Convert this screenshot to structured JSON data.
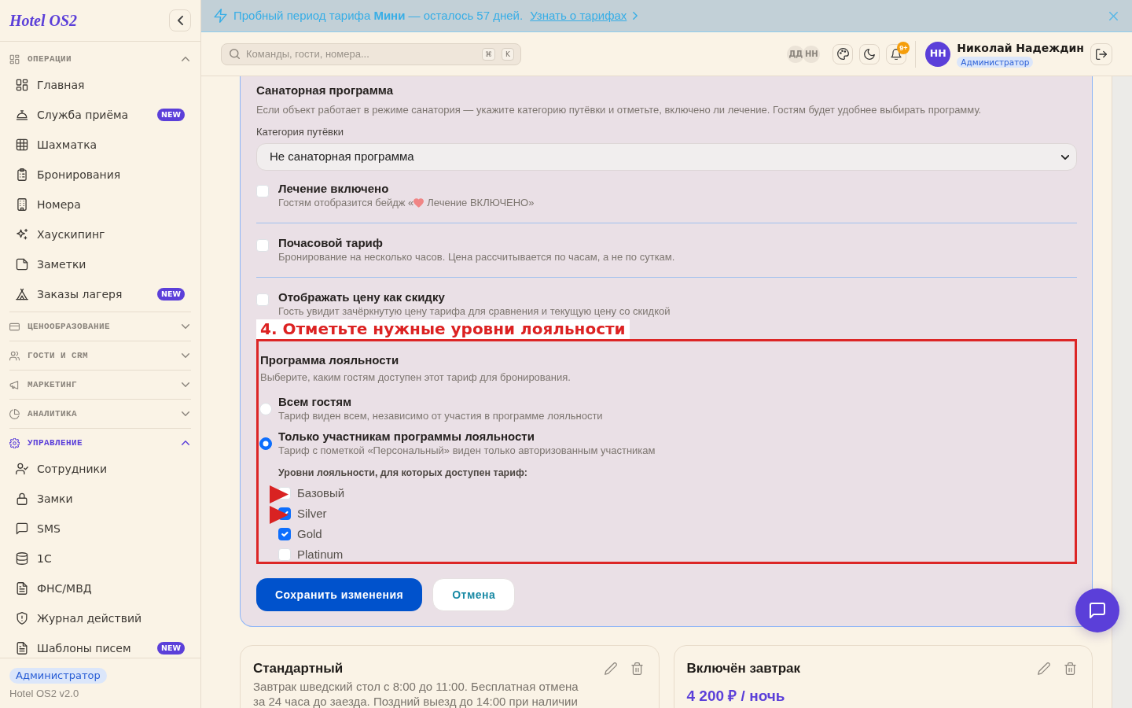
{
  "sidebar": {
    "brand": "Hotel OS2",
    "sections": [
      {
        "title": "ОПЕРАЦИИ",
        "expanded": true,
        "selected": false,
        "items": [
          {
            "label": "Главная"
          },
          {
            "label": "Служба приёма",
            "badge": "NEW"
          },
          {
            "label": "Шахматка"
          },
          {
            "label": "Бронирования"
          },
          {
            "label": "Номера"
          },
          {
            "label": "Хаускипинг"
          },
          {
            "label": "Заметки"
          },
          {
            "label": "Заказы лагеря",
            "badge": "NEW"
          }
        ]
      },
      {
        "title": "ЦЕНООБРАЗОВАНИЕ",
        "expanded": false,
        "selected": false
      },
      {
        "title": "ГОСТИ И CRM",
        "expanded": false,
        "selected": false
      },
      {
        "title": "МАРКЕТИНГ",
        "expanded": false,
        "selected": false
      },
      {
        "title": "АНАЛИТИКА",
        "expanded": false,
        "selected": false
      },
      {
        "title": "УПРАВЛЕНИЕ",
        "expanded": true,
        "selected": true,
        "items": [
          {
            "label": "Сотрудники"
          },
          {
            "label": "Замки"
          },
          {
            "label": "SMS"
          },
          {
            "label": "1С"
          },
          {
            "label": "ФНС/МВД"
          },
          {
            "label": "Журнал действий"
          },
          {
            "label": "Шаблоны писем",
            "badge": "NEW"
          }
        ]
      }
    ],
    "footer": {
      "role": "Администратор",
      "version": "Hotel OS2 v2.0"
    }
  },
  "banner": {
    "message": "Пробный период тарифа **Мини** — осталось 57 дней.",
    "link": "Узнать о тарифах"
  },
  "topbar": {
    "search": {
      "placeholder": "Команды, гости, номера...",
      "shortcut": [
        "⌘",
        "K"
      ]
    },
    "presence": [
      "ДД",
      "НН"
    ],
    "notifications": "9+",
    "user": {
      "initials": "НН",
      "name": "Николай Надеждин",
      "role": "Администратор"
    }
  },
  "form": {
    "sanatorium": {
      "title": "Санаторная программа",
      "description": "Если объект работает в режиме санатория — укажите категорию путёвки и отметьте, включено ли лечение. Гостям будет удобнее выбирать программу.",
      "category_label": "Категория путёвки",
      "category_value": "Не санаторная программа"
    },
    "options": [
      {
        "title": "Лечение включено",
        "hint": "Гостям отобразится бейдж «",
        "hint_tail": "Лечение ВКЛЮЧЕНО»",
        "checked": false
      },
      {
        "title": "Почасовой тариф",
        "hint": "Бронирование на несколько часов. Цена рассчитывается по часам, а не по суткам.",
        "checked": false
      },
      {
        "title": "Отображать цену как скидку",
        "hint": "Гость увидит зачёркнутую цену тарифа для сравнения и текущую цену со скидкой",
        "checked": false
      }
    ],
    "annotation": "4. Отметьте нужные уровни лояльности",
    "loyalty": {
      "title": "Программа лояльности",
      "description": "Выберите, каким гостям доступен этот тариф для бронирования.",
      "audiences": [
        {
          "title": "Всем гостям",
          "hint": "Тариф виден всем, независимо от участия в программе лояльности",
          "selected": false
        },
        {
          "title": "Только участникам программы лояльности",
          "hint": "Тариф с пометкой «Персональный» виден только авторизованным участникам",
          "selected": true
        }
      ],
      "levels_label": "Уровни лояльности, для которых доступен тариф:",
      "levels": [
        {
          "label": "Базовый",
          "checked": false,
          "pointed": true
        },
        {
          "label": "Silver",
          "checked": true,
          "pointed": true
        },
        {
          "label": "Gold",
          "checked": true,
          "pointed": false
        },
        {
          "label": "Platinum",
          "checked": false,
          "pointed": false
        }
      ]
    },
    "actions": [
      {
        "label": "Сохранить изменения",
        "kind": "primary"
      },
      {
        "label": "Отмена",
        "kind": "secondary"
      }
    ]
  },
  "rates": [
    {
      "title": "Стандартный",
      "description": "Завтрак шведский стол с 8:00 до 11:00. Бесплатная отмена за 24 часа до заезда. Поздний выезд до 14:00 при наличии"
    },
    {
      "title": "Включён завтрак",
      "price": "4 200 ₽ / ночь"
    }
  ]
}
